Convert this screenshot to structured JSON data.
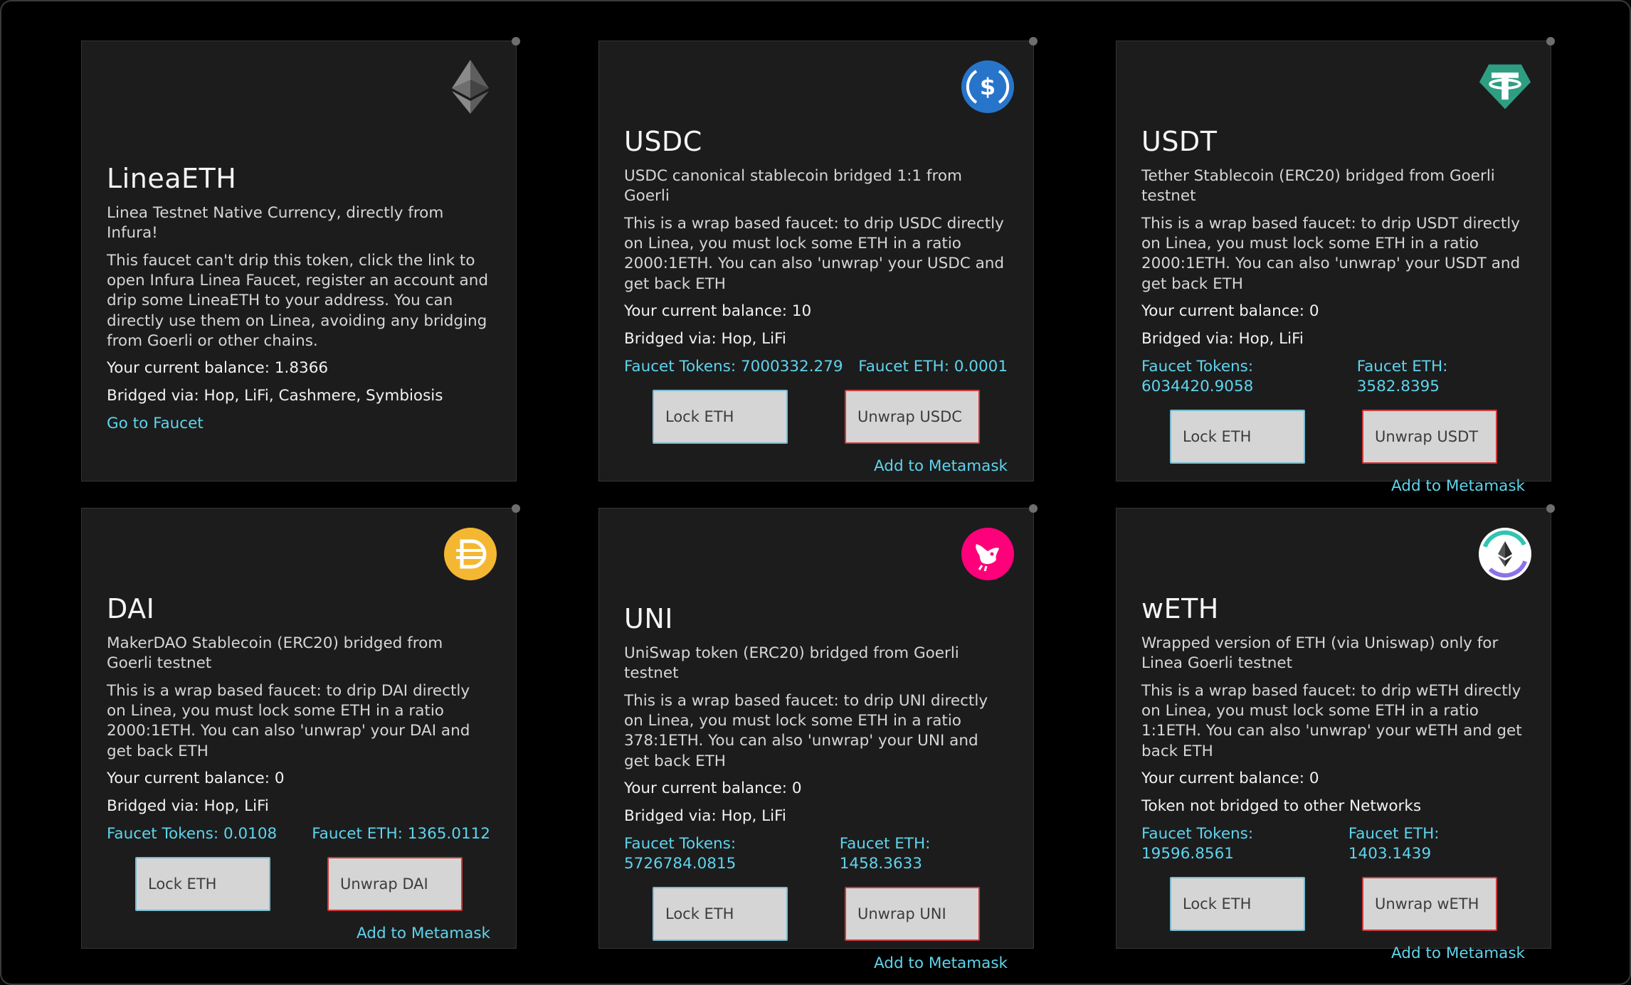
{
  "cards": [
    {
      "token": "LineaETH",
      "subtitle": "Linea Testnet Native Currency, directly from Infura!",
      "description": "This faucet can't drip this token, click the link to open Infura Linea Faucet, register an account and drip some LineaETH to your address. You can directly use them on Linea, avoiding any bridging from Goerli or other chains.",
      "balance": "Your current balance: 1.8366",
      "bridged": "Bridged via: Hop, LiFi, Cashmere, Symbiosis",
      "faucet_link": "Go to Faucet"
    },
    {
      "token": "USDC",
      "subtitle": "USDC canonical stablecoin bridged 1:1 from Goerli",
      "description": "This is a wrap based faucet: to drip USDC directly on Linea, you must lock some ETH in a ratio 2000:1ETH. You can also 'unwrap' your USDC and get back ETH",
      "balance": "Your current balance: 10",
      "bridged": "Bridged via: Hop, LiFi",
      "faucet_tokens": "Faucet Tokens: 7000332.279",
      "faucet_eth": "Faucet ETH: 0.0001",
      "lock_label": "Lock ETH",
      "unwrap_label": "Unwrap USDC",
      "metamask_label": "Add to Metamask"
    },
    {
      "token": "USDT",
      "subtitle": "Tether Stablecoin (ERC20) bridged from Goerli testnet",
      "description": "This is a wrap based faucet: to drip USDT directly on Linea, you must lock some ETH in a ratio 2000:1ETH. You can also 'unwrap' your USDT and get back ETH",
      "balance": "Your current balance: 0",
      "bridged": "Bridged via: Hop, LiFi",
      "faucet_tokens": "Faucet Tokens: 6034420.9058",
      "faucet_eth": "Faucet ETH: 3582.8395",
      "lock_label": "Lock ETH",
      "unwrap_label": "Unwrap USDT",
      "metamask_label": "Add to Metamask"
    },
    {
      "token": "DAI",
      "subtitle": "MakerDAO Stablecoin (ERC20) bridged from Goerli testnet",
      "description": "This is a wrap based faucet: to drip DAI directly on Linea, you must lock some ETH in a ratio 2000:1ETH. You can also 'unwrap' your DAI and get back ETH",
      "balance": "Your current balance: 0",
      "bridged": "Bridged via: Hop, LiFi",
      "faucet_tokens": "Faucet Tokens: 0.0108",
      "faucet_eth": "Faucet ETH: 1365.0112",
      "lock_label": "Lock ETH",
      "unwrap_label": "Unwrap DAI",
      "metamask_label": "Add to Metamask"
    },
    {
      "token": "UNI",
      "subtitle": "UniSwap token (ERC20) bridged from Goerli testnet",
      "description": "This is a wrap based faucet: to drip UNI directly on Linea, you must lock some ETH in a ratio 378:1ETH. You can also 'unwrap' your UNI and get back ETH",
      "balance": "Your current balance: 0",
      "bridged": "Bridged via: Hop, LiFi",
      "faucet_tokens": "Faucet Tokens: 5726784.0815",
      "faucet_eth": "Faucet ETH: 1458.3633",
      "lock_label": "Lock ETH",
      "unwrap_label": "Unwrap UNI",
      "metamask_label": "Add to Metamask"
    },
    {
      "token": "wETH",
      "subtitle": "Wrapped version of ETH (via Uniswap) only for Linea Goerli testnet",
      "description": "This is a wrap based faucet: to drip wETH directly on Linea, you must lock some ETH in a ratio 1:1ETH. You can also 'unwrap' your wETH and get back ETH",
      "balance": "Your current balance: 0",
      "bridged": "Token not bridged to other Networks",
      "faucet_tokens": "Faucet Tokens: 19596.8561",
      "faucet_eth": "Faucet ETH: 1403.1439",
      "lock_label": "Lock ETH",
      "unwrap_label": "Unwrap wETH",
      "metamask_label": "Add to Metamask"
    }
  ],
  "icons": [
    "eth-icon",
    "usdc-icon",
    "usdt-icon",
    "dai-icon",
    "uni-icon",
    "weth-icon"
  ],
  "colors": {
    "accent_link": "#5fd4ec",
    "card_bg": "#1c1c1d",
    "usdc": "#2775ca",
    "usdt": "#2e9e83",
    "dai": "#f4b731",
    "uni": "#ff007a"
  }
}
